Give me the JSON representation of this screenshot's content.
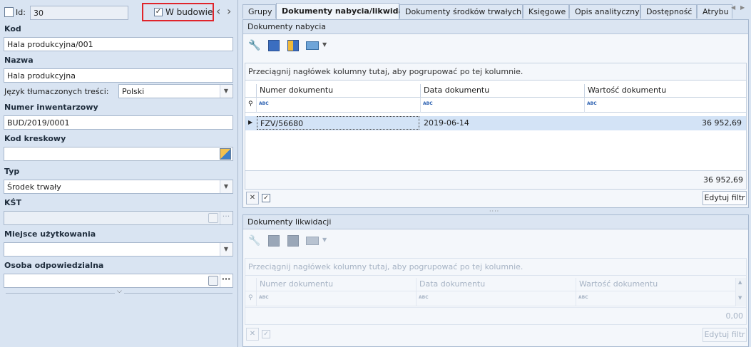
{
  "left": {
    "id_label": "Id:",
    "id_value": "30",
    "in_build_checkbox": "✓",
    "in_build_label": "W budowie",
    "nav_prev": "‹",
    "nav_next": "›",
    "kod_label": "Kod",
    "kod_value": "Hala produkcyjna/001",
    "nazwa_label": "Nazwa",
    "nazwa_value": "Hala produkcyjna",
    "jezyk_label": "Język tłumaczonych treści:",
    "jezyk_value": "Polski",
    "numer_label": "Numer inwentarzowy",
    "numer_value": "BUD/2019/0001",
    "kod_kreskowy_label": "Kod kreskowy",
    "kod_kreskowy_value": "",
    "typ_label": "Typ",
    "typ_value": "Środek trwały",
    "kst_label": "KŚT",
    "kst_value": "",
    "miejsce_label": "Miejsce użytkowania",
    "miejsce_value": "",
    "osoba_label": "Osoba odpowiedzialna",
    "osoba_value": "",
    "ellipsis": "···"
  },
  "tabs": [
    {
      "label": "Grupy"
    },
    {
      "label": "Dokumenty nabycia/likwidacji"
    },
    {
      "label": "Dokumenty środków trwałych"
    },
    {
      "label": "Księgowe"
    },
    {
      "label": "Opis analityczny"
    },
    {
      "label": "Dostępność"
    },
    {
      "label": "Atrybu"
    }
  ],
  "nabycia": {
    "title": "Dokumenty nabycia",
    "group_hint": "Przeciągnij nagłówek kolumny tutaj, aby pogrupować po tej kolumnie.",
    "columns": [
      "Numer dokumentu",
      "Data dokumentu",
      "Wartość dokumentu"
    ],
    "filter_icon": "ABC",
    "rows": [
      {
        "numer": "FZV/56680",
        "data": "2019-06-14",
        "wartosc": "36 952,69"
      }
    ],
    "total": "36 952,69",
    "edit_filter": "Edytuj filtr"
  },
  "likwidacji": {
    "title": "Dokumenty likwidacji",
    "group_hint": "Przeciągnij nagłówek kolumny tutaj, aby pogrupować po tej kolumnie.",
    "columns": [
      "Numer dokumentu",
      "Data dokumentu",
      "Wartość dokumentu"
    ],
    "filter_icon": "ABC",
    "total": "0,00",
    "edit_filter": "Edytuj filtr"
  },
  "colors": {
    "accent_red": "#e0242b",
    "selected_row": "#d3e3f6"
  }
}
